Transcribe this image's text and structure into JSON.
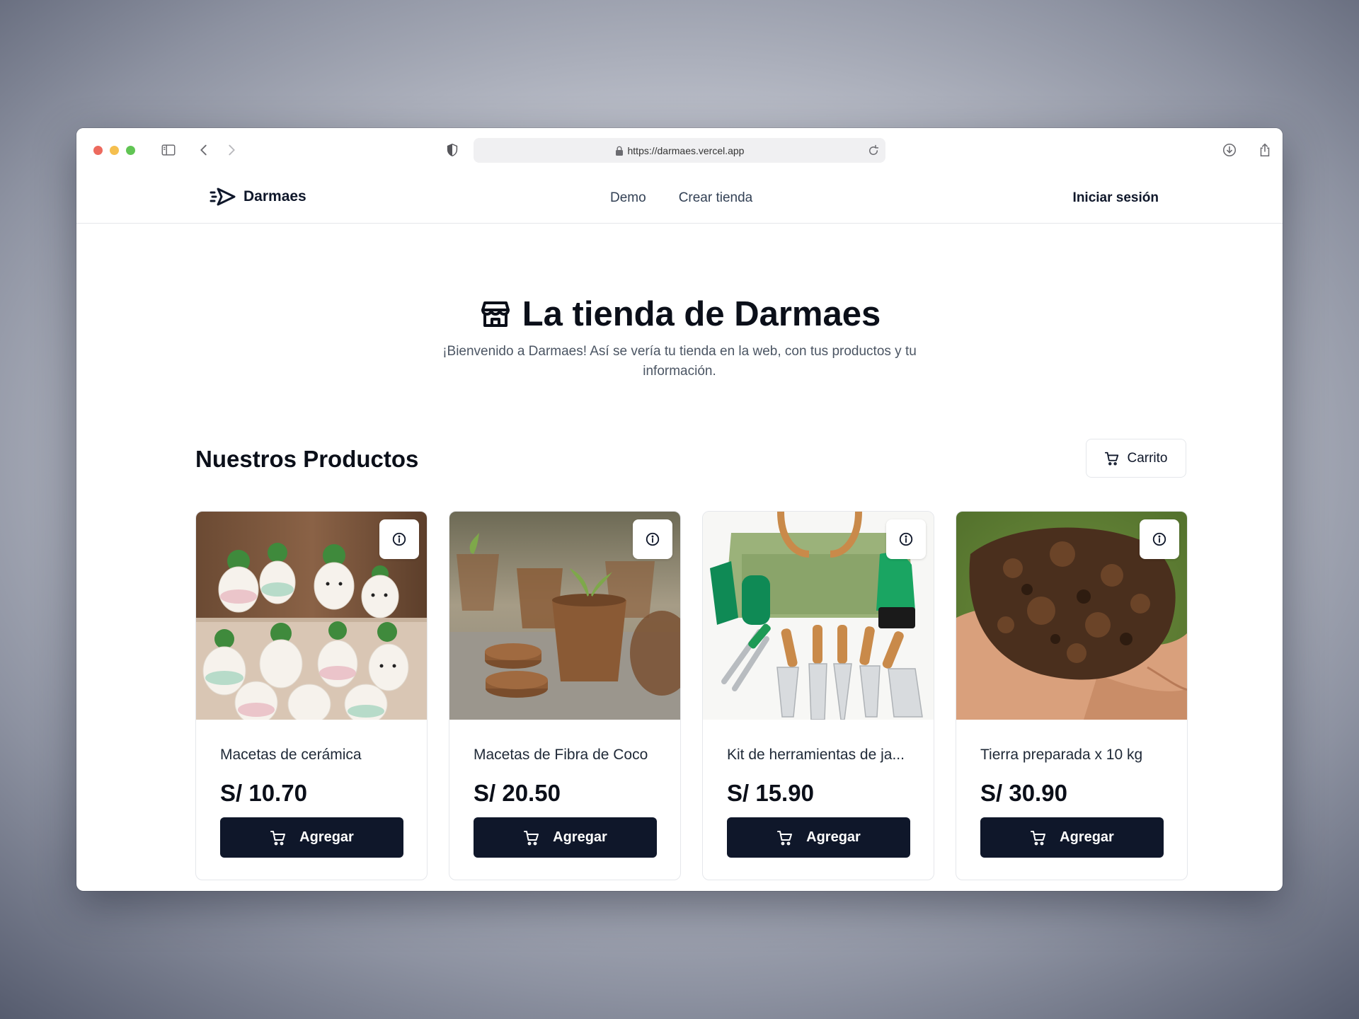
{
  "browser": {
    "url": "https://darmaes.vercel.app"
  },
  "nav": {
    "brand": "Darmaes",
    "links": [
      "Demo",
      "Crear tienda"
    ],
    "login": "Iniciar sesión"
  },
  "hero": {
    "title": "La tienda de Darmaes",
    "subtitle": "¡Bienvenido a Darmaes! Así se vería tu tienda en la web, con tus productos y tu información."
  },
  "products_section": {
    "title": "Nuestros Productos",
    "cart_label": "Carrito"
  },
  "products": [
    {
      "name": "Macetas de cerámica",
      "price": "S/ 10.70",
      "button": "Agregar"
    },
    {
      "name": "Macetas de Fibra de Coco",
      "price": "S/ 20.50",
      "button": "Agregar"
    },
    {
      "name": "Kit de herramientas de ja...",
      "price": "S/ 15.90",
      "button": "Agregar"
    },
    {
      "name": "Tierra preparada x 10 kg",
      "price": "S/ 30.90",
      "button": "Agregar"
    }
  ],
  "colors": {
    "primary_button": "#0f172a",
    "text_dark": "#0b0f19"
  }
}
